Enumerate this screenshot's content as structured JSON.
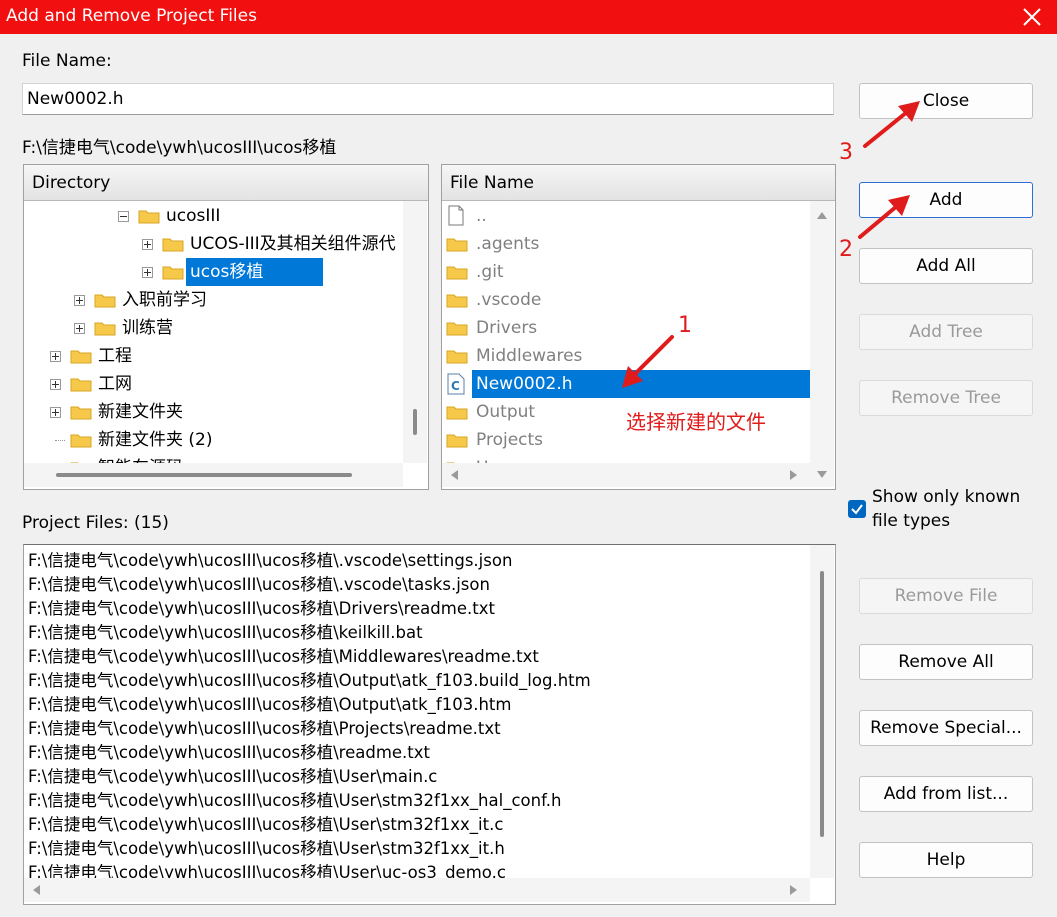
{
  "window": {
    "title": "Add and Remove Project Files"
  },
  "file_name": {
    "label": "File Name:",
    "value": "New0002.h"
  },
  "current_path": "F:\\信捷电气\\code\\ywh\\ucosIII\\ucos移植",
  "directory": {
    "header": "Directory",
    "items": [
      {
        "label": "ucosIII",
        "indent": 5,
        "expander": "minus"
      },
      {
        "label": "UCOS-III及其相关组件源代",
        "indent": 6,
        "expander": "plus"
      },
      {
        "label": "ucos移植",
        "indent": 6,
        "expander": "plus",
        "selected": true
      },
      {
        "label": "入职前学习",
        "indent": 3,
        "expander": "plus"
      },
      {
        "label": "训练营",
        "indent": 3,
        "expander": "plus"
      },
      {
        "label": "工程",
        "indent": 2,
        "expander": "plus"
      },
      {
        "label": "工网",
        "indent": 2,
        "expander": "plus"
      },
      {
        "label": "新建文件夹",
        "indent": 2,
        "expander": "plus"
      },
      {
        "label": "新建文件夹 (2)",
        "indent": 2,
        "expander": "none"
      },
      {
        "label": "智能车源码",
        "indent": 2,
        "expander": "plus"
      }
    ]
  },
  "files": {
    "header": "File Name",
    "items": [
      {
        "label": "..",
        "type": "file-icon"
      },
      {
        "label": ".agents",
        "type": "folder-icon"
      },
      {
        "label": ".git",
        "type": "folder-icon"
      },
      {
        "label": ".vscode",
        "type": "folder-icon"
      },
      {
        "label": "Drivers",
        "type": "folder-icon"
      },
      {
        "label": "Middlewares",
        "type": "folder-icon"
      },
      {
        "label": "New0002.h",
        "type": "c-file-icon",
        "selected": true
      },
      {
        "label": "Output",
        "type": "folder-icon"
      },
      {
        "label": "Projects",
        "type": "folder-icon"
      },
      {
        "label": "User",
        "type": "folder-icon"
      }
    ]
  },
  "project_files": {
    "label": "Project Files: (15)",
    "items": [
      "F:\\信捷电气\\code\\ywh\\ucosIII\\ucos移植\\.vscode\\settings.json",
      "F:\\信捷电气\\code\\ywh\\ucosIII\\ucos移植\\.vscode\\tasks.json",
      "F:\\信捷电气\\code\\ywh\\ucosIII\\ucos移植\\Drivers\\readme.txt",
      "F:\\信捷电气\\code\\ywh\\ucosIII\\ucos移植\\keilkill.bat",
      "F:\\信捷电气\\code\\ywh\\ucosIII\\ucos移植\\Middlewares\\readme.txt",
      "F:\\信捷电气\\code\\ywh\\ucosIII\\ucos移植\\Output\\atk_f103.build_log.htm",
      "F:\\信捷电气\\code\\ywh\\ucosIII\\ucos移植\\Output\\atk_f103.htm",
      "F:\\信捷电气\\code\\ywh\\ucosIII\\ucos移植\\Projects\\readme.txt",
      "F:\\信捷电气\\code\\ywh\\ucosIII\\ucos移植\\readme.txt",
      "F:\\信捷电气\\code\\ywh\\ucosIII\\ucos移植\\User\\main.c",
      "F:\\信捷电气\\code\\ywh\\ucosIII\\ucos移植\\User\\stm32f1xx_hal_conf.h",
      "F:\\信捷电气\\code\\ywh\\ucosIII\\ucos移植\\User\\stm32f1xx_it.c",
      "F:\\信捷电气\\code\\ywh\\ucosIII\\ucos移植\\User\\stm32f1xx_it.h",
      "F:\\信捷电气\\code\\ywh\\ucosIII\\ucos移植\\User\\uc-os3_demo.c"
    ]
  },
  "buttons": {
    "close": "Close",
    "add": "Add",
    "add_all": "Add All",
    "add_tree": "Add Tree",
    "remove_tree": "Remove Tree",
    "remove_file": "Remove File",
    "remove_all": "Remove All",
    "remove_special": "Remove Special...",
    "add_from_list": "Add from list...",
    "help": "Help"
  },
  "show_known": {
    "label_line1": "Show only known",
    "label_line2": "file types",
    "checked": true
  },
  "annotations": {
    "step1": "1",
    "step1_note": "选择新建的文件",
    "step2": "2",
    "step3": "3",
    "color": "#e01b1b"
  },
  "colors": {
    "titlebar": "#f20f0f",
    "selection": "#0078d7",
    "folder": "#f7c94a"
  }
}
